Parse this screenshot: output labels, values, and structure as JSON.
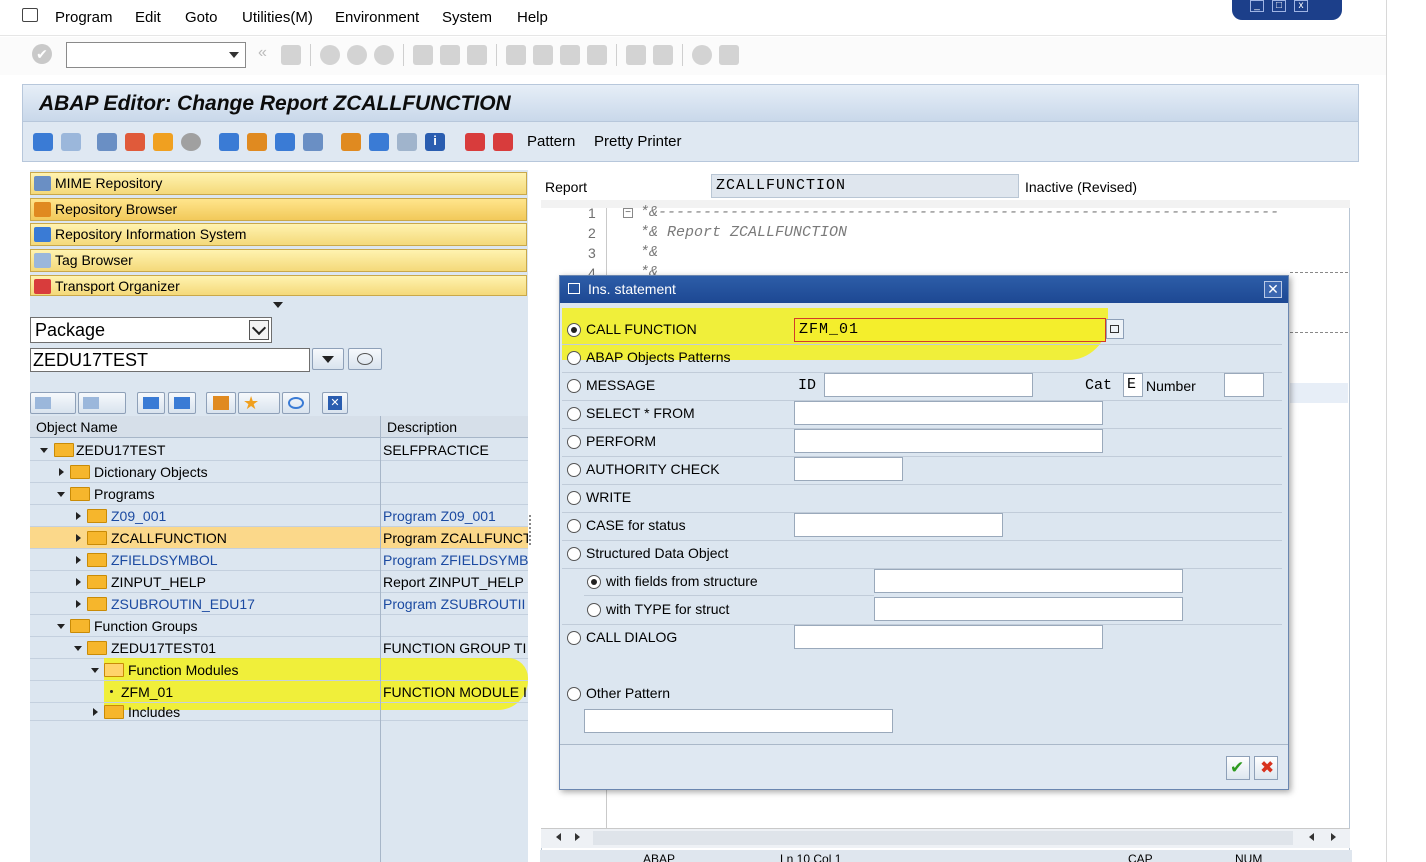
{
  "menu": {
    "items": [
      "Program",
      "Edit",
      "Goto",
      "Utilities(M)",
      "Environment",
      "System",
      "Help"
    ]
  },
  "window": {
    "title": "ABAP Editor: Change Report ZCALLFUNCTION"
  },
  "app_toolbar": {
    "pattern_label": "Pattern",
    "pretty_printer_label": "Pretty Printer"
  },
  "nav": {
    "buttons": [
      "MIME Repository",
      "Repository Browser",
      "Repository Information System",
      "Tag Browser",
      "Transport Organizer"
    ],
    "object_type": "Package",
    "object_name": "ZEDU17TEST"
  },
  "tree": {
    "col_name": "Object Name",
    "col_desc": "Description",
    "rows": [
      {
        "name": "ZEDU17TEST",
        "desc": "SELFPRACTICE"
      },
      {
        "name": "Dictionary Objects",
        "desc": ""
      },
      {
        "name": "Programs",
        "desc": ""
      },
      {
        "name": "Z09_001",
        "desc": "Program Z09_001"
      },
      {
        "name": "ZCALLFUNCTION",
        "desc": "Program ZCALLFUNCT"
      },
      {
        "name": "ZFIELDSYMBOL",
        "desc": "Program ZFIELDSYMB"
      },
      {
        "name": "ZINPUT_HELP",
        "desc": "Report ZINPUT_HELP"
      },
      {
        "name": "ZSUBROUTIN_EDU17",
        "desc": "Program ZSUBROUTII"
      },
      {
        "name": "Function Groups",
        "desc": ""
      },
      {
        "name": "ZEDU17TEST01",
        "desc": "FUNCTION GROUP TI"
      },
      {
        "name": "Function Modules",
        "desc": ""
      },
      {
        "name": "ZFM_01",
        "desc": "FUNCTION MODULE I"
      },
      {
        "name": "Includes",
        "desc": ""
      }
    ]
  },
  "editor": {
    "report_label": "Report",
    "report_name": "ZCALLFUNCTION",
    "status": "Inactive (Revised)",
    "lines": [
      {
        "num": "1",
        "text": "*&---------------------------------------------------------------------"
      },
      {
        "num": "2",
        "text": "*& Report  ZCALLFUNCTION"
      },
      {
        "num": "3",
        "text": "*&"
      },
      {
        "num": "4",
        "text": "*&"
      }
    ],
    "status_bar": {
      "lang": "ABAP",
      "pos": "Ln 10 Col 1",
      "cap": "CAP",
      "num": "NUM"
    }
  },
  "dialog": {
    "title": "Ins. statement",
    "options": {
      "call_function": "CALL FUNCTION",
      "abap_objects": "ABAP Objects Patterns",
      "message": "MESSAGE",
      "select": "SELECT * FROM",
      "perform": "PERFORM",
      "authority": "AUTHORITY CHECK",
      "write": "WRITE",
      "case": "CASE for status",
      "structured": "Structured Data Object",
      "with_fields": "with fields from structure",
      "with_type": "with TYPE for struct",
      "call_dialog": "CALL DIALOG",
      "other": "Other Pattern"
    },
    "call_function_value": "ZFM_01",
    "message_id_label": "ID",
    "message_cat_label": "Cat",
    "message_cat_value": "E",
    "message_number_label": "Number"
  }
}
